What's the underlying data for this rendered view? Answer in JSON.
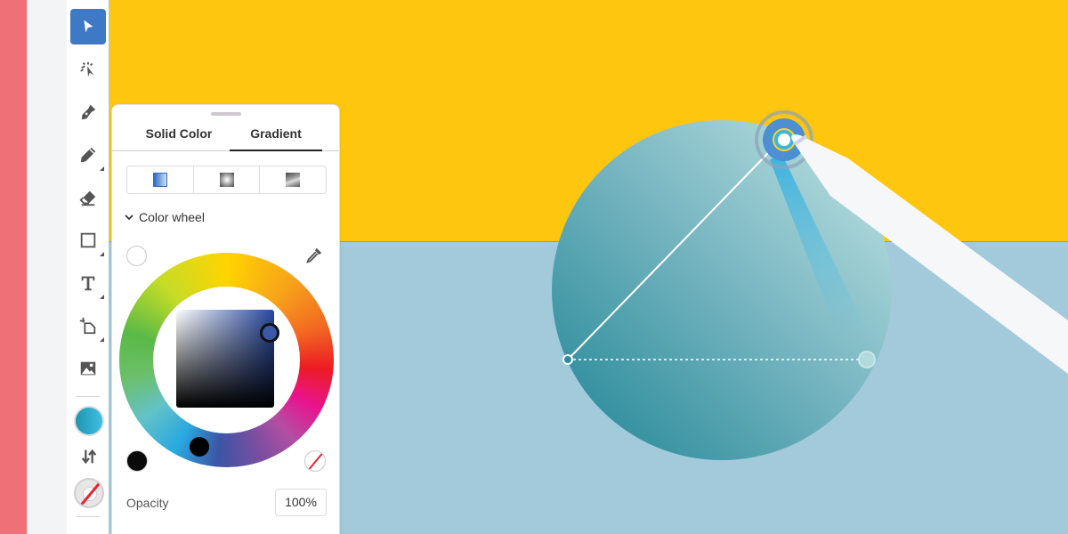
{
  "toolbar": {
    "tools": [
      {
        "name": "selection",
        "icon": "arrow-pointer-icon",
        "active": true
      },
      {
        "name": "direct-selection",
        "icon": "node-select-icon",
        "active": false
      },
      {
        "name": "pen",
        "icon": "pen-nib-icon",
        "active": false
      },
      {
        "name": "pencil",
        "icon": "pencil-icon",
        "active": false
      },
      {
        "name": "eraser",
        "icon": "eraser-icon",
        "active": false
      },
      {
        "name": "shape",
        "icon": "rectangle-icon",
        "active": false
      },
      {
        "name": "type",
        "icon": "type-icon",
        "active": false
      },
      {
        "name": "crop",
        "icon": "crop-icon",
        "active": false
      },
      {
        "name": "image",
        "icon": "image-icon",
        "active": false
      }
    ],
    "fill_color": "#22a3c4",
    "stroke": "none"
  },
  "color_panel": {
    "tabs": [
      {
        "label": "Solid Color",
        "selected": false
      },
      {
        "label": "Gradient",
        "selected": true
      }
    ],
    "gradient_types": [
      "linear",
      "radial",
      "freeform"
    ],
    "selected_gradient_type": "linear",
    "section_label": "Color wheel",
    "selected_color": "#3a58a8",
    "opacity_label": "Opacity",
    "opacity_value": "100%"
  },
  "canvas": {
    "background_top": "#ffc60f",
    "background_bottom": "#a2cadb",
    "circle_gradient": [
      "#2b8d9e",
      "#b5dfe0"
    ]
  }
}
